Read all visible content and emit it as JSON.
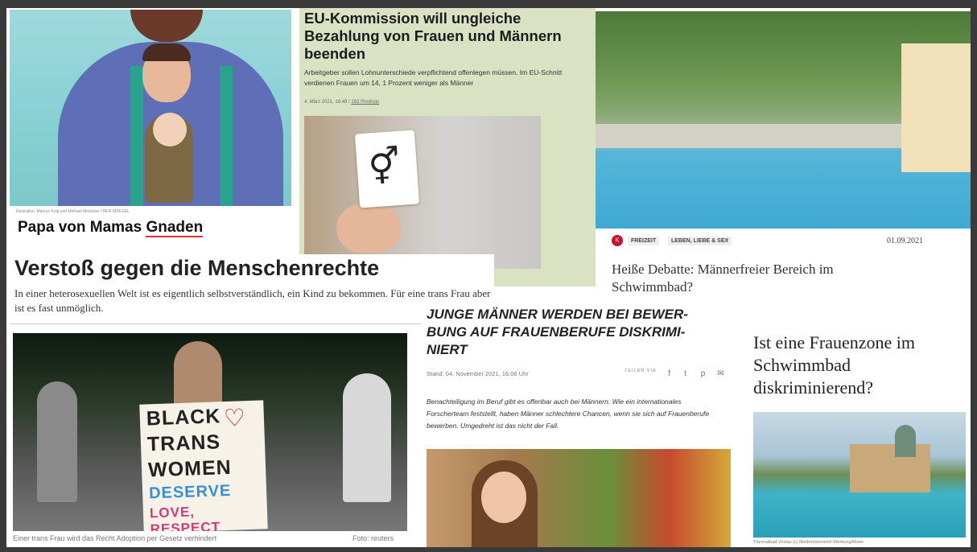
{
  "papa": {
    "credit": "Illustration: Marcus Koig und Michael Meissner / DER SPIEGEL",
    "title_a": "Papa von Mamas ",
    "title_b": "Gnaden"
  },
  "eu": {
    "title": "EU-Kommission will ungleiche Bezahlung von Frauen und Männern beenden",
    "lead": "Arbeitgeber sollen Lohnunterschiede verpflichtend offenlegen müssen. Im EU-Schnitt verdienen Frauen um 14, 1 Prozent weniger als Männer",
    "meta_date": "4. März 2021, 18:49",
    "meta_sep": " / ",
    "meta_link": "163 Postings",
    "card_symbol": "⚥"
  },
  "pool": {
    "logo": "K",
    "tag1": "FREIZEIT",
    "tag2": "LEBEN, LIEBE & SEX",
    "date": "01.09.2021",
    "title": "Heiße Debatte: Männerfreier Bereich im Schwimmbad?"
  },
  "verstoss": {
    "title": "Verstoß gegen die Menschenrechte",
    "lead": "In einer heterosexuellen Welt ist es eigentlich selbstverständlich, ein Kind zu bekommen. Für eine trans Frau aber ist es fast unmöglich."
  },
  "black": {
    "sign_lines": [
      "BLACK",
      "TRANS",
      "WOMEN",
      "DESERVE",
      "LOVE, RESPECT"
    ],
    "heart": "♡",
    "caption": "Einer trans Frau wird das Recht Adoption per Gesetz verhindert",
    "credit": "Foto: reuters"
  },
  "junge": {
    "title": "JUNGE MÄNNER WERDEN BEI BEWER- BUNG AUF FRAUENBERUFE DISKRIMI- NIERT",
    "meta": "Stand: 04. November 2021, 16:06 Uhr",
    "share_label": "TEILEN VIA",
    "icons": [
      "facebook-icon",
      "twitter-icon",
      "pinterest-icon",
      "mail-icon"
    ],
    "icon_glyphs": [
      "f",
      "t",
      "p",
      "✉"
    ],
    "lead": "Benachteiligung im Beruf gibt es offenbar auch bei Männern. Wie ein internationales Forscherteam feststellt, haben Männer schlechtere Chancen, wenn sie sich auf Frauenberufe bewerben. Umgedreht ist das nicht der Fall."
  },
  "zone": {
    "title": "Ist eine Frauenzone im Schwimmbad diskriminierend?",
    "caption": "Thermalbad Vöslau   (c) Niederösterreich-Werbung/Rowe"
  }
}
